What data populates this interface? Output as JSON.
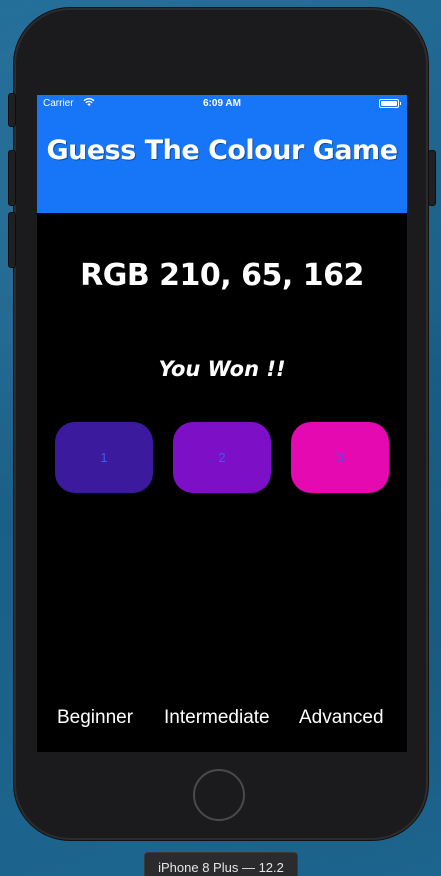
{
  "status_bar": {
    "carrier": "Carrier",
    "time": "6:09 AM",
    "wifi_icon": "wifi-icon",
    "battery_icon": "battery-icon"
  },
  "header": {
    "title": "Guess The Colour Game",
    "background_color": "#1776f7"
  },
  "game": {
    "rgb_text": "RGB 210, 65, 162",
    "result_text": "You Won !!",
    "choices": [
      {
        "label": "1",
        "color": "#3b1a9e"
      },
      {
        "label": "2",
        "color": "#7d0fc6"
      },
      {
        "label": "3",
        "color": "#e409b0"
      }
    ]
  },
  "levels": {
    "beginner": "Beginner",
    "intermediate": "Intermediate",
    "advanced": "Advanced"
  },
  "simulator": {
    "device_label": "iPhone 8 Plus — 12.2"
  }
}
